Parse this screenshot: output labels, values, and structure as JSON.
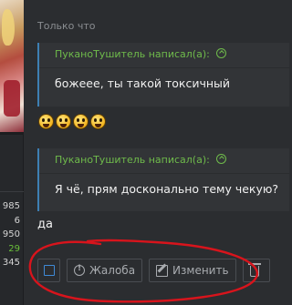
{
  "post": {
    "time": "Только что",
    "quotes": [
      {
        "author": "ПуканоТушитель написал(а):",
        "text": "божеее, ты такой токсичный"
      },
      {
        "author": "ПуканоТушитель написал(а):",
        "text": "Я чё, прям досконально тему чекую?"
      }
    ],
    "smilies": [
      "smiley-icon",
      "smiley-icon",
      "smiley-icon",
      "smiley-icon"
    ],
    "reply": "да"
  },
  "user_stats": [
    "985",
    "6",
    "950",
    "29",
    "345"
  ],
  "actions": {
    "report_label": "Жалоба",
    "edit_label": "Изменить"
  },
  "colors": {
    "background": "#2b2d30",
    "quote_accent": "#3d7fb3",
    "author_green": "#6fbb4b",
    "annotation_red": "#d8141c"
  }
}
